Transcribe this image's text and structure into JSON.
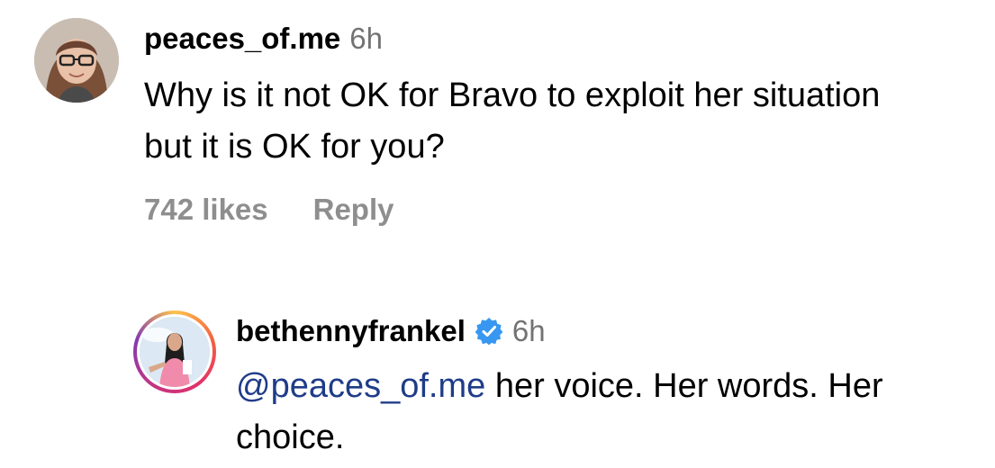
{
  "comment": {
    "username": "peaces_of.me",
    "timestamp": "6h",
    "text": "Why is it not OK for Bravo to exploit her situation but it is OK for you?",
    "likes": "742 likes",
    "reply_label": "Reply"
  },
  "reply": {
    "username": "bethennyfrankel",
    "verified": true,
    "timestamp": "6h",
    "mention": "@peaces_of.me",
    "text": " her voice. Her words. Her choice."
  },
  "colors": {
    "text": "#000000",
    "secondary": "#737373",
    "muted": "#8e8e8e",
    "mention": "#1f3c88",
    "verified_badge": "#3897f0"
  }
}
